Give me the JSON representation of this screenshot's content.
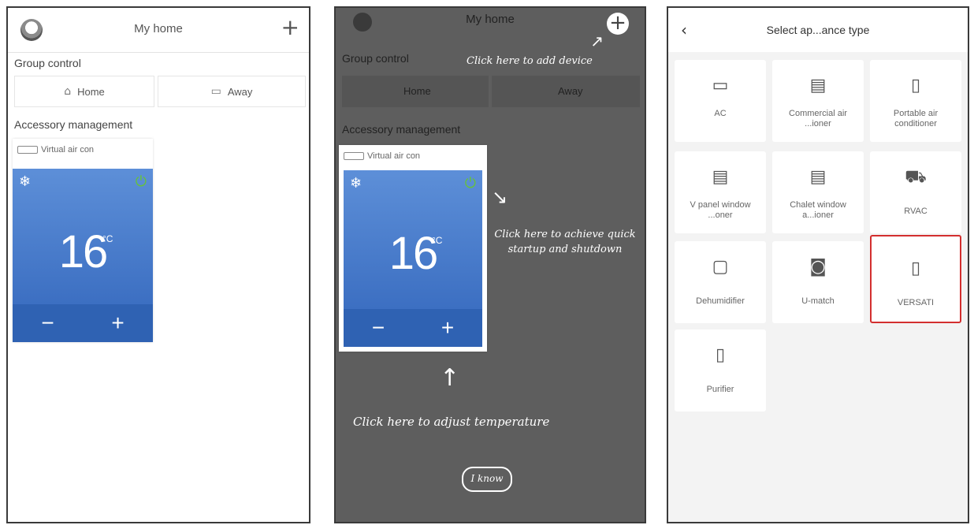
{
  "panel1": {
    "header": {
      "title": "My home"
    },
    "group_control": "Group control",
    "group_buttons": [
      {
        "label": "Home",
        "icon": "home-icon"
      },
      {
        "label": "Away",
        "icon": "away-icon"
      }
    ],
    "accessory_management": "Accessory management",
    "device": {
      "name": "Virtual air con",
      "temperature": "16",
      "unit": "°C"
    }
  },
  "panel2": {
    "header": {
      "title": "My home"
    },
    "group_control": "Group control",
    "group_buttons": [
      {
        "label": "Home"
      },
      {
        "label": "Away"
      }
    ],
    "accessory_management": "Accessory management",
    "device": {
      "name": "Virtual air con",
      "temperature": "16",
      "unit": "°C"
    },
    "annotations": {
      "add_device": "Click here to add device",
      "quick_startup": "Click here to achieve quick startup and shutdown",
      "adjust_temp": "Click here to adjust temperature"
    },
    "confirm_button": "I know"
  },
  "panel3": {
    "header": {
      "title": "Select ap...ance type"
    },
    "types": [
      {
        "label": "AC",
        "icon": "ac-icon"
      },
      {
        "label": "Commercial air ...ioner",
        "icon": "commercial-ac-icon"
      },
      {
        "label": "Portable air conditioner",
        "icon": "portable-ac-icon"
      },
      {
        "label": "V panel window ...oner",
        "icon": "window-ac-icon"
      },
      {
        "label": "Chalet window a...ioner",
        "icon": "chalet-ac-icon"
      },
      {
        "label": "RVAC",
        "icon": "rv-icon"
      },
      {
        "label": "Dehumidifier",
        "icon": "dehumidifier-icon"
      },
      {
        "label": "U-match",
        "icon": "umatch-icon"
      },
      {
        "label": "VERSATI",
        "icon": "versati-icon",
        "highlighted": true
      },
      {
        "label": "Purifier",
        "icon": "purifier-icon"
      }
    ]
  },
  "colors": {
    "ac_blue": "#2f62b3",
    "power_green": "#67c23a",
    "highlight_red": "#d32f2f"
  }
}
